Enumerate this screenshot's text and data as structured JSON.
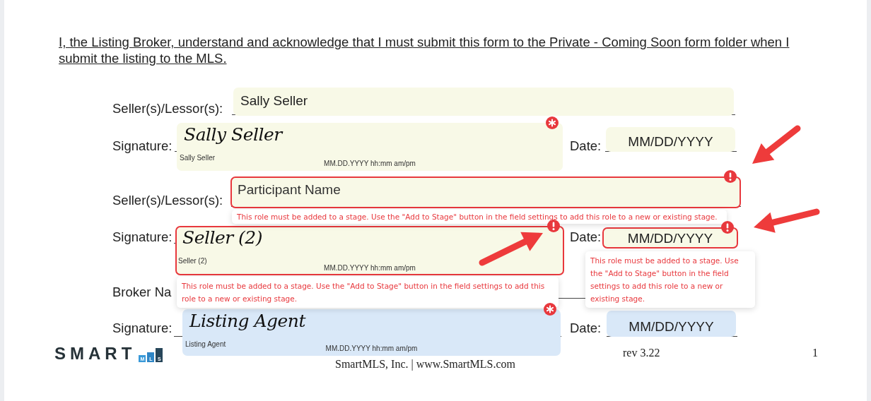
{
  "notice": "I, the Listing Broker, understand and acknowledge that I must submit this form to the Private - Coming Soon form folder when I submit the listing to the MLS.",
  "labels": [
    "Seller(s)/Lessor(s):",
    "Signature:",
    "Date:",
    "Seller(s)/Lessor(s):",
    "Signature:",
    "Date:",
    "Broker Na",
    "Signature:",
    "Date:"
  ],
  "fields": [
    {
      "kind": "text",
      "value": "Sally Seller",
      "color": "#f8f9e7",
      "error": false
    },
    {
      "kind": "signature",
      "value": "Sally Seller",
      "caption": "Sally Seller",
      "timestamp": "MM.DD.YYYY hh:mm am/pm",
      "color": "#f8f9e7",
      "required": true,
      "error": false
    },
    {
      "kind": "date",
      "value": "MM/DD/YYYY",
      "color": "#f8f9e7",
      "error": false
    },
    {
      "kind": "text",
      "placeholder": "Participant Name",
      "color": "#f8f9e7",
      "error": true
    },
    {
      "kind": "signature",
      "value": "Seller (2)",
      "caption": "Seller (2)",
      "timestamp": "MM.DD.YYYY hh:mm am/pm",
      "color": "#f8f9e7",
      "error": true
    },
    {
      "kind": "date",
      "value": "MM/DD/YYYY",
      "color": "#f8f9e7",
      "error": true
    },
    {
      "kind": "signature",
      "value": "Listing Agent",
      "caption": "Listing Agent",
      "timestamp": "MM.DD.YYYY hh:mm am/pm",
      "color": "#d9e8f8",
      "required": true,
      "error": false
    },
    {
      "kind": "date",
      "value": "MM/DD/YYYY",
      "color": "#d9e8f8",
      "error": false
    }
  ],
  "tooltips": [
    "This role must be added to a stage. Use the \"Add to Stage\" button in the field settings to add this role to a new or existing stage.",
    "This role must be added to a stage. Use the \"Add to Stage\" button in the field settings to add this role to a new or existing stage.",
    "This role must be added to a stage. Use the \"Add to Stage\" button in the field settings to add this role to a new or existing stage."
  ],
  "footer": {
    "logo": "SMART",
    "logo_letters": [
      "M",
      "L",
      "S"
    ],
    "company": "SmartMLS, Inc. | www.SmartMLS.com",
    "revision": "rev 3.22",
    "page": "1"
  }
}
